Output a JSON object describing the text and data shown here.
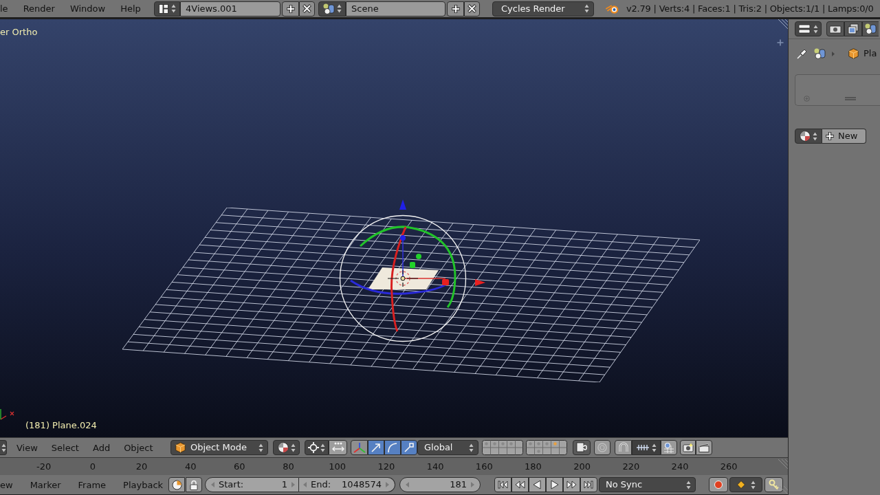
{
  "top_bar": {
    "menus": [
      "le",
      "Render",
      "Window",
      "Help"
    ],
    "screen_layout": "4Views.001",
    "scene": "Scene",
    "render_engine": "Cycles Render",
    "stats": "v2.79 | Verts:4 | Faces:1 | Tris:2 | Objects:1/1 | Lamps:0/0"
  },
  "viewport": {
    "view_name": "er Ortho",
    "object_info": "(181) Plane.024"
  },
  "viewport_header": {
    "menus": [
      "View",
      "Select",
      "Add",
      "Object"
    ],
    "mode": "Object Mode",
    "manipulators": [
      {
        "kind": "translate",
        "selected": true
      },
      {
        "kind": "rotate",
        "selected": true
      },
      {
        "kind": "scale",
        "selected": true
      }
    ],
    "orientation": "Global"
  },
  "timeline": {
    "ruler": [
      "-20",
      "0",
      "20",
      "40",
      "60",
      "80",
      "100",
      "120",
      "140",
      "160",
      "180",
      "200",
      "220",
      "240",
      "260"
    ],
    "menus": [
      "ew",
      "Marker",
      "Frame",
      "Playback"
    ],
    "start": {
      "label": "Start:",
      "value": "1"
    },
    "end": {
      "label": "End:",
      "value": "1048574"
    },
    "current_frame": "181",
    "sync": "No Sync"
  },
  "properties": {
    "context": "Pla",
    "new_button": "New"
  }
}
